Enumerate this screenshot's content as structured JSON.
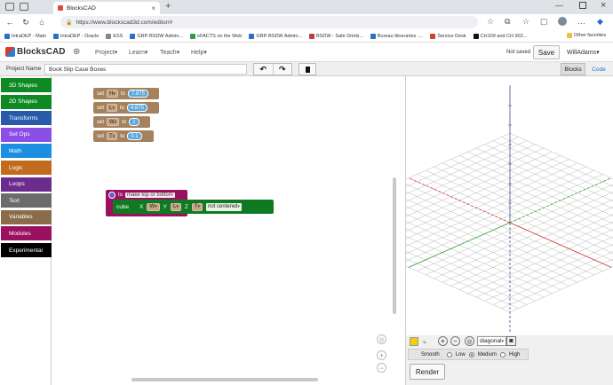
{
  "browser": {
    "tab_title": "BlocksCAD",
    "url": "https://www.blockscad3d.com/editor/#",
    "bookmarks": [
      "IntraDEP - Main",
      "IntraDEP - Oracle",
      "ESS",
      "GRP-BSDW Admin...",
      "eFACTS on the Web",
      "GRP-BSDW Admin...",
      "BSDW - Safe Drinki...",
      "Bureau Itineraries -...",
      "Service Desk",
      "CH109 and CH 302..."
    ],
    "other_favorites": "Other favorites"
  },
  "app": {
    "logo": "BlocksCAD",
    "menu": [
      "Project",
      "Learn",
      "Teach",
      "Help"
    ],
    "status": "Not saved",
    "save_label": "Save",
    "user": "WillAdams"
  },
  "toolbar": {
    "project_name_label": "Project Name",
    "project_name_value": "Book Slip Case Boxes",
    "view_tabs": [
      "Blocks",
      "Code"
    ]
  },
  "categories": [
    {
      "label": "3D Shapes",
      "color": "#0f8a23"
    },
    {
      "label": "2D Shapes",
      "color": "#0f8a23"
    },
    {
      "label": "Transforms",
      "color": "#275aa8"
    },
    {
      "label": "Set Ops",
      "color": "#8c4fe6"
    },
    {
      "label": "Math",
      "color": "#1c8fe0"
    },
    {
      "label": "Logic",
      "color": "#c26b1c"
    },
    {
      "label": "Loops",
      "color": "#6b2c8e"
    },
    {
      "label": "Text",
      "color": "#6b6b6b"
    },
    {
      "label": "Variables",
      "color": "#8b6c4a"
    },
    {
      "label": "Modules",
      "color": "#9a1160"
    },
    {
      "label": "Experimental",
      "color": "#000000"
    }
  ],
  "blocks": {
    "sets": [
      {
        "word": "set",
        "var": "H",
        "to": "to",
        "value": "7.875"
      },
      {
        "word": "set",
        "var": "L",
        "to": "to",
        "value": "4.875"
      },
      {
        "word": "set",
        "var": "W",
        "to": "to",
        "value": "1"
      },
      {
        "word": "set",
        "var": "T",
        "to": "to",
        "value": "0.1"
      }
    ],
    "module": {
      "to": "to",
      "name": "make top or bottom"
    },
    "cube": {
      "label": "cube",
      "x_label": "X",
      "x_var": "W",
      "y_label": "Y",
      "y_var": "L",
      "z_label": "Z",
      "z_var": "T",
      "centered": "not centered"
    }
  },
  "view_controls": {
    "view_select": "diagonal",
    "smooth_label": "Smooth",
    "smooth_options": [
      "Low",
      "Medium",
      "High"
    ],
    "smooth_selected": "Medium",
    "render_label": "Render",
    "swatch_color": "#f5d000"
  }
}
